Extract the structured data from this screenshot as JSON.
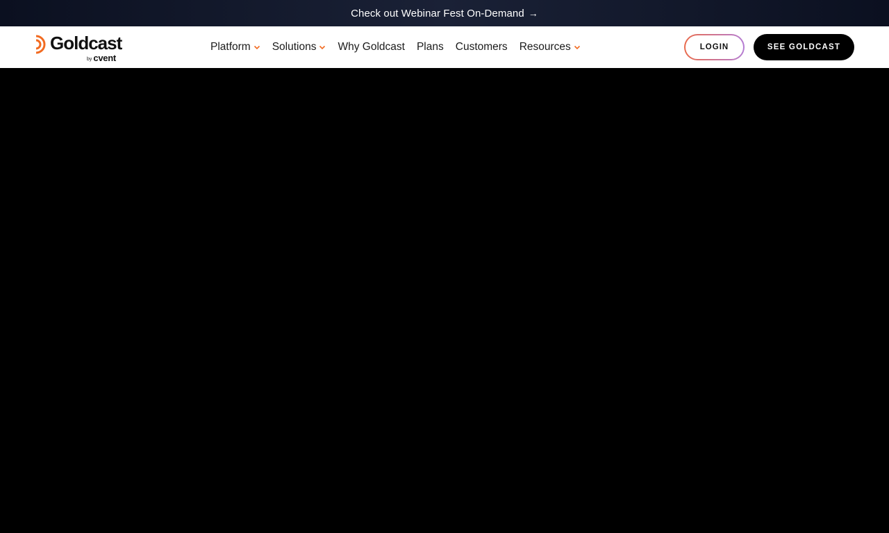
{
  "announcement": {
    "text": "Check out Webinar Fest On-Demand",
    "arrow": "→"
  },
  "logo": {
    "name": "Goldcast",
    "by": "by",
    "parent": "cvent",
    "mark_color": "#f26b21"
  },
  "nav": {
    "items": [
      {
        "label": "Platform",
        "has_dropdown": true
      },
      {
        "label": "Solutions",
        "has_dropdown": true
      },
      {
        "label": "Why Goldcast",
        "has_dropdown": false
      },
      {
        "label": "Plans",
        "has_dropdown": false
      },
      {
        "label": "Customers",
        "has_dropdown": false
      },
      {
        "label": "Resources",
        "has_dropdown": true
      }
    ],
    "chevron_color": "#f26b21"
  },
  "actions": {
    "login_label": "LOGIN",
    "cta_label": "SEE GOLDCAST"
  },
  "colors": {
    "announcement_bg": "#0b1020",
    "navbar_bg": "#ffffff",
    "hero_bg": "#000000",
    "cta_bg": "#000000",
    "login_border_start": "#e96b4c",
    "login_border_end": "#b47cd4"
  }
}
